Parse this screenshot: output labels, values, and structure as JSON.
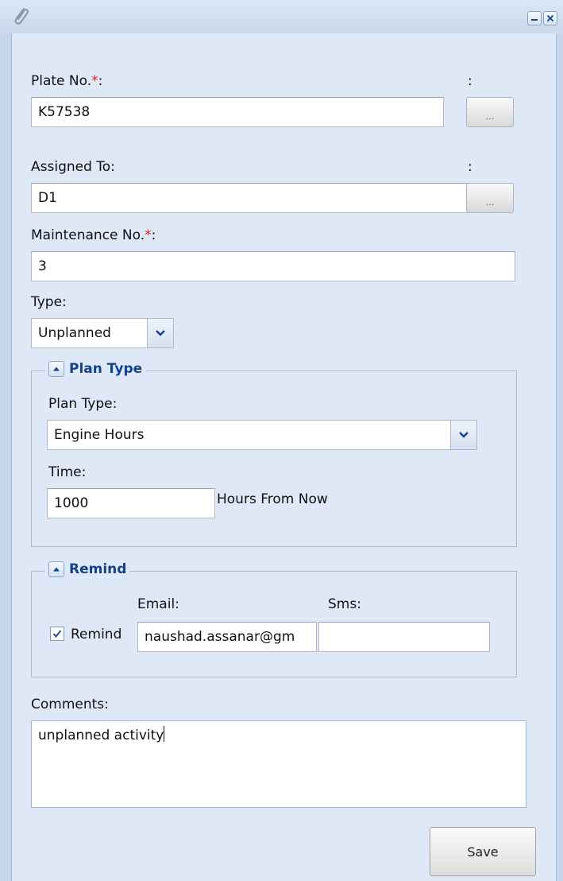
{
  "form": {
    "plate": {
      "label": "Plate No.",
      "required_mark": "*",
      "colon": ":",
      "side_colon": ":",
      "value": "K57538",
      "browse_label": "..."
    },
    "assigned": {
      "label": "Assigned To:",
      "side_colon": ":",
      "value": "D1",
      "browse_label": "..."
    },
    "maintenance": {
      "label": "Maintenance No.",
      "required_mark": "*",
      "colon": ":",
      "value": "3"
    },
    "type": {
      "label": "Type:",
      "value": "Unplanned"
    },
    "plan_type_section": {
      "legend": "Plan Type",
      "plan_type_label": "Plan Type:",
      "plan_type_value": "Engine Hours",
      "time_label": "Time:",
      "time_value": "1000",
      "time_unit": "Hours From Now"
    },
    "remind_section": {
      "legend": "Remind",
      "remind_label": "Remind",
      "remind_checked": true,
      "email_label": "Email:",
      "email_value": "naushad.assanar@gm",
      "sms_label": "Sms:",
      "sms_value": ""
    },
    "comments": {
      "label": "Comments:",
      "value": "unplanned activity"
    },
    "save_label": "Save"
  },
  "icons": {
    "window": "paperclip-icon",
    "minimize": "minimize-icon",
    "close": "close-icon",
    "dropdown": "chevron-down-icon",
    "collapse": "collapse-up-icon",
    "checkbox": "checkmark-icon"
  },
  "colors": {
    "legend_text": "#15428b",
    "panel_bg": "#dfe8f6",
    "required": "#e02020"
  }
}
